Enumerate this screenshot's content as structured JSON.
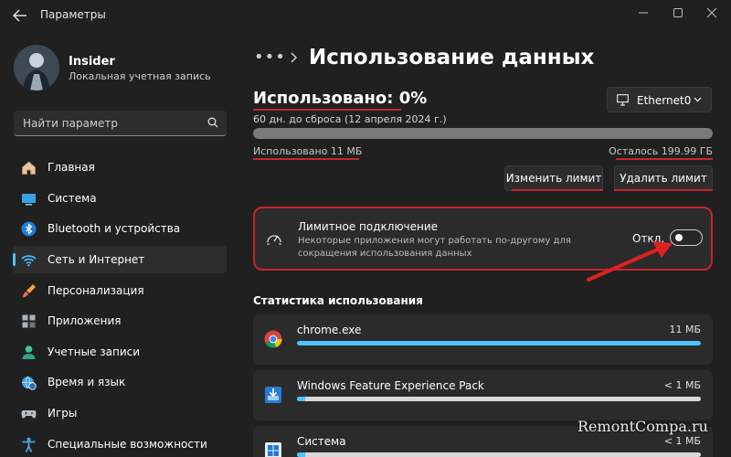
{
  "window": {
    "title": "Параметры"
  },
  "user": {
    "name": "Insider",
    "account_type": "Локальная учетная запись"
  },
  "search": {
    "placeholder": "Найти параметр"
  },
  "sidebar": {
    "items": [
      {
        "label": "Главная",
        "icon": "home-icon",
        "active": false
      },
      {
        "label": "Система",
        "icon": "system-icon",
        "active": false
      },
      {
        "label": "Bluetooth и устройства",
        "icon": "bluetooth-icon",
        "active": false
      },
      {
        "label": "Сеть и Интернет",
        "icon": "wifi-icon",
        "active": true
      },
      {
        "label": "Персонализация",
        "icon": "brush-icon",
        "active": false
      },
      {
        "label": "Приложения",
        "icon": "apps-icon",
        "active": false
      },
      {
        "label": "Учетные записи",
        "icon": "account-icon",
        "active": false
      },
      {
        "label": "Время и язык",
        "icon": "globe-clock-icon",
        "active": false
      },
      {
        "label": "Игры",
        "icon": "gamepad-icon",
        "active": false
      },
      {
        "label": "Специальные возможности",
        "icon": "accessibility-icon",
        "active": false
      }
    ]
  },
  "header": {
    "breadcrumb_dots": "•••",
    "title": "Использование данных"
  },
  "usage": {
    "title": "Использовано: 0%",
    "reset_info": "60 дн. до сброса (12 апреля 2024 г.)",
    "progress_fraction": 0.0,
    "used": "Использовано 11 МБ",
    "remaining": "Осталось 199.99 ГБ"
  },
  "adapter": {
    "label": "Ethernet0",
    "icon": "monitor-icon"
  },
  "buttons": {
    "change_limit": "Изменить лимит",
    "delete_limit": "Удалить лимит"
  },
  "metered": {
    "title": "Лимитное подключение",
    "description": "Некоторые приложения могут работать по-другому для сокращения использования данных",
    "toggle_label": "Откл.",
    "toggle_on": false
  },
  "stats": {
    "title": "Статистика использования",
    "apps": [
      {
        "name": "chrome.exe",
        "size": "11 МБ",
        "fraction": 1.0,
        "icon": "chrome-icon"
      },
      {
        "name": "Windows Feature Experience Pack",
        "size": "< 1 МБ",
        "fraction": 0.02,
        "icon": "feature-pack-icon"
      },
      {
        "name": "Система",
        "size": "< 1 МБ",
        "fraction": 0.02,
        "icon": "windows-system-icon"
      }
    ]
  },
  "watermark": "RemontCompa.ru",
  "colors": {
    "accent": "#4cc2ff",
    "annotation_red": "#c8252c",
    "background": "#202020",
    "card": "#2b2b2b"
  }
}
